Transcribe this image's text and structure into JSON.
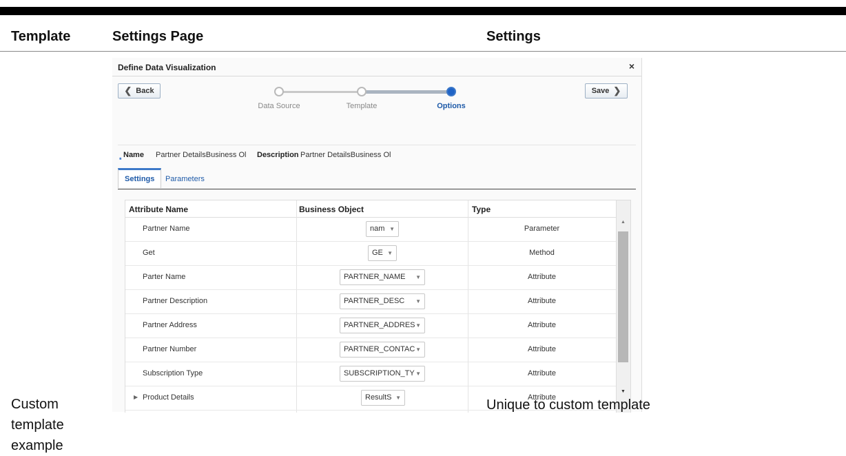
{
  "headers": {
    "template": "Template",
    "settings_page": "Settings Page",
    "settings": "Settings"
  },
  "left_note": [
    "Custom",
    "template",
    "example"
  ],
  "right_note": "Unique to custom template",
  "dialog": {
    "title": "Define Data Visualization",
    "close": "×",
    "back_label": "Back",
    "save_label": "Save",
    "train": {
      "steps": [
        "Data Source",
        "Template",
        "Options"
      ],
      "current_step": "Options"
    },
    "name_label": "Name",
    "name_value": "Partner DetailsBusiness Ol",
    "description_label": "Description",
    "description_value": "Partner DetailsBusiness Ol",
    "tabs": [
      {
        "label": "Settings",
        "active": true
      },
      {
        "label": "Parameters",
        "active": false
      }
    ],
    "columns": [
      "Attribute Name",
      "Business Object",
      "Type"
    ],
    "rows": [
      {
        "name": "Partner Name",
        "object": "nam",
        "type": "Parameter"
      },
      {
        "name": "Get",
        "object": "GE",
        "type": "Method"
      },
      {
        "name": "Parter Name",
        "object": "PARTNER_NAME",
        "type": "Attribute"
      },
      {
        "name": "Partner Description",
        "object": "PARTNER_DESC",
        "type": "Attribute"
      },
      {
        "name": "Partner Address",
        "object": "PARTNER_ADDRES",
        "type": "Attribute"
      },
      {
        "name": "Partner Number",
        "object": "PARTNER_CONTAC",
        "type": "Attribute"
      },
      {
        "name": "Subscription Type",
        "object": "SUBSCRIPTION_TY",
        "type": "Attribute"
      },
      {
        "name": "Product Details",
        "object": "ResultS",
        "type": "Attribute"
      }
    ]
  },
  "colors": {
    "accent": "#1f63c6",
    "link": "#1e5aa8",
    "train_visited": "#b9b9b9"
  }
}
